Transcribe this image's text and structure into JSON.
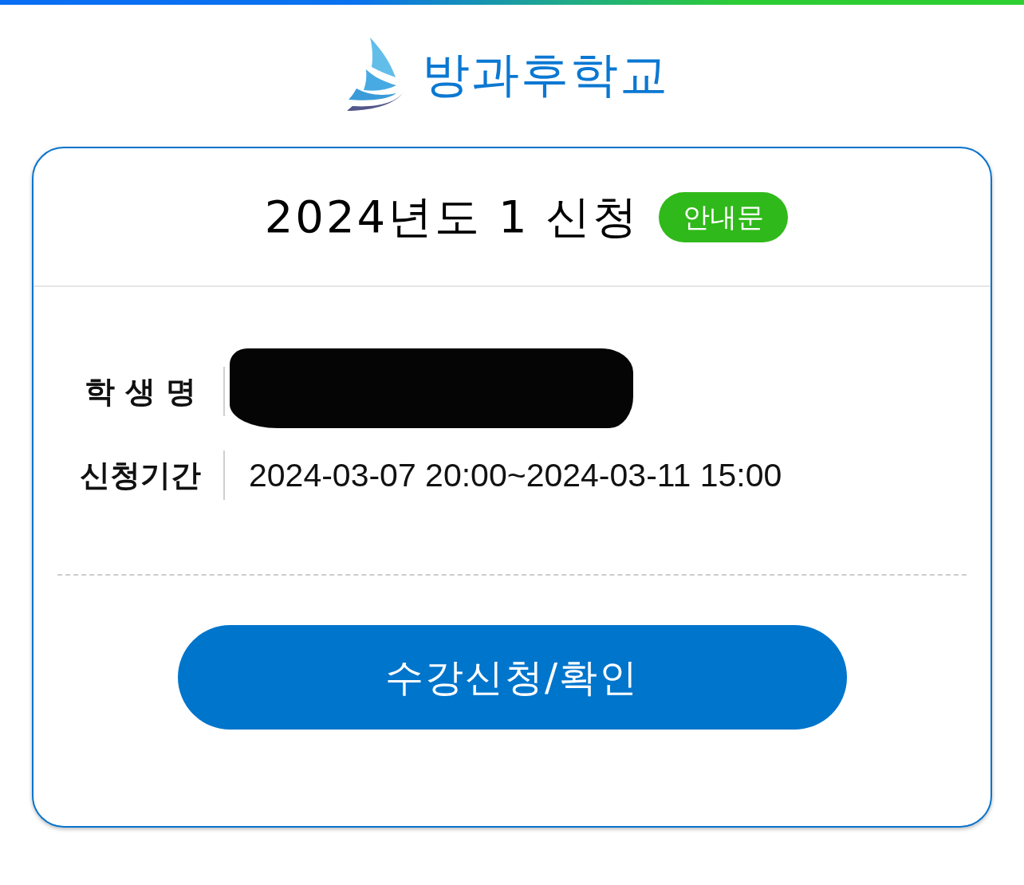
{
  "header": {
    "logo_text": "방과후학교"
  },
  "card": {
    "title": "2024년도 1 신청",
    "badge": "안내문",
    "fields": [
      {
        "label": "학 생 명",
        "kind": "redacted"
      },
      {
        "label": "신청기간",
        "kind": "text",
        "value": "2024-03-07 20:00~2024-03-11 15:00"
      }
    ],
    "button": "수강신청/확인"
  }
}
